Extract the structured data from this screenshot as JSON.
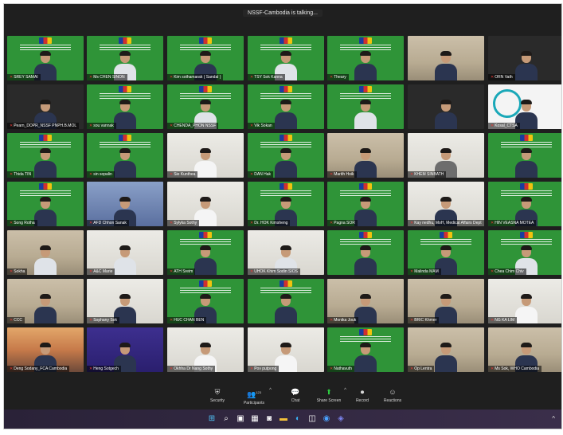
{
  "header": {
    "talking": "NSSF-Cambodia is talking..."
  },
  "participants": [
    {
      "name": "SREY SAMAI",
      "style": "green",
      "shirt": ""
    },
    {
      "name": "Ms CHEN SINON",
      "style": "green",
      "shirt": "light-shirt"
    },
    {
      "name": "Kim sothamarak ( Sandal )",
      "style": "green",
      "shirt": ""
    },
    {
      "name": "TSY Sok Kanna",
      "style": "green",
      "shirt": "light-shirt"
    },
    {
      "name": "Theary",
      "style": "green",
      "shirt": ""
    },
    {
      "name": "",
      "style": "room",
      "shirt": ""
    },
    {
      "name": "ORN Vath",
      "style": "dark",
      "shirt": ""
    },
    {
      "name": "Pearn_DOPR_NSSF PNPH.B.MOL",
      "style": "dark",
      "shirt": ""
    },
    {
      "name": "sou vannak",
      "style": "green",
      "shirt": ""
    },
    {
      "name": "CHENDA_PHON NSSF",
      "style": "green",
      "shirt": "light-shirt"
    },
    {
      "name": "Vik Sokan",
      "style": "green",
      "shirt": ""
    },
    {
      "name": "",
      "style": "green",
      "shirt": "light-shirt"
    },
    {
      "name": "",
      "style": "dark",
      "shirt": ""
    },
    {
      "name": "Kosal_CTSA",
      "style": "logo",
      "shirt": ""
    },
    {
      "name": "Thida TIN",
      "style": "green",
      "shirt": ""
    },
    {
      "name": "sin sopalin",
      "style": "green",
      "shirt": ""
    },
    {
      "name": "Sie Kunthea",
      "style": "light",
      "shirt": "white-shirt"
    },
    {
      "name": "DAN Hak",
      "style": "green",
      "shirt": ""
    },
    {
      "name": "Marith Hoik",
      "style": "room",
      "shirt": ""
    },
    {
      "name": "KHEM SINBATH",
      "style": "light",
      "shirt": "grey-shirt"
    },
    {
      "name": "",
      "style": "green",
      "shirt": ""
    },
    {
      "name": "Song Rotha",
      "style": "green",
      "shirt": ""
    },
    {
      "name": "AFD Chhon Sanak",
      "style": "blue",
      "shirt": ""
    },
    {
      "name": "Sylyka Sothy",
      "style": "light",
      "shirt": "white-shirt"
    },
    {
      "name": "Dr. HOK Kimsheng",
      "style": "green",
      "shirt": ""
    },
    {
      "name": "Pagna SOR",
      "style": "green",
      "shirt": ""
    },
    {
      "name": "Kay nedhu, MoH, Medical Affairs Dept",
      "style": "light",
      "shirt": ""
    },
    {
      "name": "HIN VEASNA MOTEA",
      "style": "green",
      "shirt": ""
    },
    {
      "name": "Sokha",
      "style": "room",
      "shirt": "light-shirt"
    },
    {
      "name": "A&C Marie",
      "style": "light",
      "shirt": "light-shirt"
    },
    {
      "name": "ATH Sreim",
      "style": "green",
      "shirt": ""
    },
    {
      "name": "UHOK Khim Sodin SIOS",
      "style": "light",
      "shirt": "light-shirt"
    },
    {
      "name": "",
      "style": "green",
      "shirt": ""
    },
    {
      "name": "Malinda MAM",
      "style": "green",
      "shirt": ""
    },
    {
      "name": "Chea Chim Chiv",
      "style": "green",
      "shirt": "light-shirt"
    },
    {
      "name": "CCC",
      "style": "room",
      "shirt": ""
    },
    {
      "name": "Sophany Sok",
      "style": "light",
      "shirt": ""
    },
    {
      "name": "HUC CHAN BEN",
      "style": "green",
      "shirt": ""
    },
    {
      "name": "",
      "style": "green",
      "shirt": ""
    },
    {
      "name": "Monika Jouk",
      "style": "room",
      "shirt": ""
    },
    {
      "name": "BRIC Khmer",
      "style": "room",
      "shirt": ""
    },
    {
      "name": "NG KA LIM",
      "style": "light",
      "shirt": "white-shirt"
    },
    {
      "name": "Deng Sodany_FCA Cambodia",
      "style": "sunset",
      "shirt": ""
    },
    {
      "name": "Heng Sotgech",
      "style": "purple",
      "shirt": ""
    },
    {
      "name": "Okhha Dr Nang Sothy",
      "style": "light",
      "shirt": "white-shirt"
    },
    {
      "name": "Pov putpong",
      "style": "light",
      "shirt": "white-shirt"
    },
    {
      "name": "Nathavuth",
      "style": "green",
      "shirt": ""
    },
    {
      "name": "Op Lentra",
      "style": "room",
      "shirt": ""
    },
    {
      "name": "Ms Sok, WHO Cambodia",
      "style": "room",
      "shirt": ""
    }
  ],
  "controls": [
    {
      "id": "security",
      "label": "Security",
      "icon": "shield",
      "name": "security-button"
    },
    {
      "id": "participants",
      "label": "Participants",
      "icon": "people",
      "count": "123",
      "name": "participants-button"
    },
    {
      "id": "chat",
      "label": "Chat",
      "icon": "chat",
      "name": "chat-button"
    },
    {
      "id": "share",
      "label": "Share Screen",
      "icon": "share",
      "name": "share-screen-button"
    },
    {
      "id": "record",
      "label": "Record",
      "icon": "record",
      "name": "record-button"
    },
    {
      "id": "reactions",
      "label": "Reactions",
      "icon": "smile",
      "name": "reactions-button"
    }
  ],
  "taskbar": [
    "windows-icon",
    "search-icon",
    "task-view-icon",
    "widgets-icon",
    "chat-icon",
    "file-explorer-icon",
    "edge-icon",
    "store-icon",
    "zoom-icon",
    "teams-icon"
  ]
}
